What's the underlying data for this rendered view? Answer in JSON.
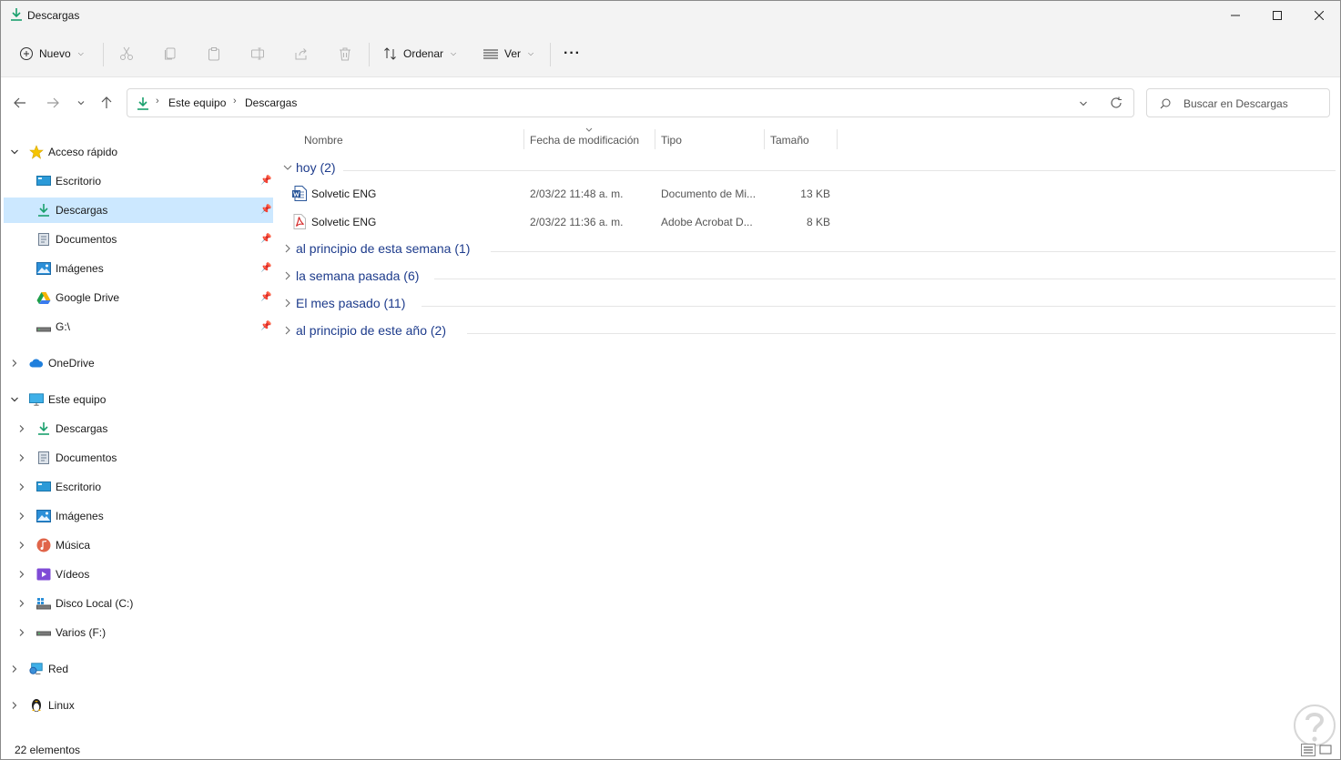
{
  "window": {
    "title": "Descargas"
  },
  "toolbar": {
    "new_label": "Nuevo",
    "sort_label": "Ordenar",
    "view_label": "Ver",
    "more_label": "···"
  },
  "address": {
    "segments": [
      "Este equipo",
      "Descargas"
    ],
    "search_placeholder": "Buscar en Descargas"
  },
  "sidebar": {
    "quick_access": "Acceso rápido",
    "quick_items": [
      {
        "label": "Escritorio",
        "icon": "desktop-icon"
      },
      {
        "label": "Descargas",
        "icon": "download-icon"
      },
      {
        "label": "Documentos",
        "icon": "documents-icon"
      },
      {
        "label": "Imágenes",
        "icon": "pictures-icon"
      },
      {
        "label": "Google Drive",
        "icon": "google-drive-icon"
      },
      {
        "label": "G:\\",
        "icon": "drive-icon"
      }
    ],
    "onedrive": "OneDrive",
    "this_pc": "Este equipo",
    "pc_items": [
      {
        "label": "Descargas",
        "icon": "download-icon"
      },
      {
        "label": "Documentos",
        "icon": "documents-icon"
      },
      {
        "label": "Escritorio",
        "icon": "desktop-icon"
      },
      {
        "label": "Imágenes",
        "icon": "pictures-icon"
      },
      {
        "label": "Música",
        "icon": "music-icon"
      },
      {
        "label": "Vídeos",
        "icon": "videos-icon"
      },
      {
        "label": "Disco Local (C:)",
        "icon": "local-disk-icon"
      },
      {
        "label": "Varios (F:)",
        "icon": "drive-icon"
      }
    ],
    "network": "Red",
    "linux": "Linux"
  },
  "columns": {
    "name": "Nombre",
    "modified": "Fecha de modificación",
    "type": "Tipo",
    "size": "Tamaño"
  },
  "groups": {
    "today": "hoy (2)",
    "early_this_week": "al principio de esta semana (1)",
    "last_week": "la semana pasada (6)",
    "last_month": "El mes pasado (11)",
    "early_this_year": "al principio de este año (2)"
  },
  "files": [
    {
      "name": "Solvetic ENG",
      "modified": "2/03/22 11:48 a. m.",
      "type": "Documento de Mi...",
      "size": "13 KB",
      "icon": "word-icon"
    },
    {
      "name": "Solvetic ENG",
      "modified": "2/03/22 11:36 a. m.",
      "type": "Adobe Acrobat D...",
      "size": "8 KB",
      "icon": "pdf-icon"
    }
  ],
  "status": {
    "count": "22 elementos"
  },
  "colors": {
    "selection": "#cce8ff",
    "group_text": "#1e3c8c",
    "accent": "#0078d4"
  }
}
